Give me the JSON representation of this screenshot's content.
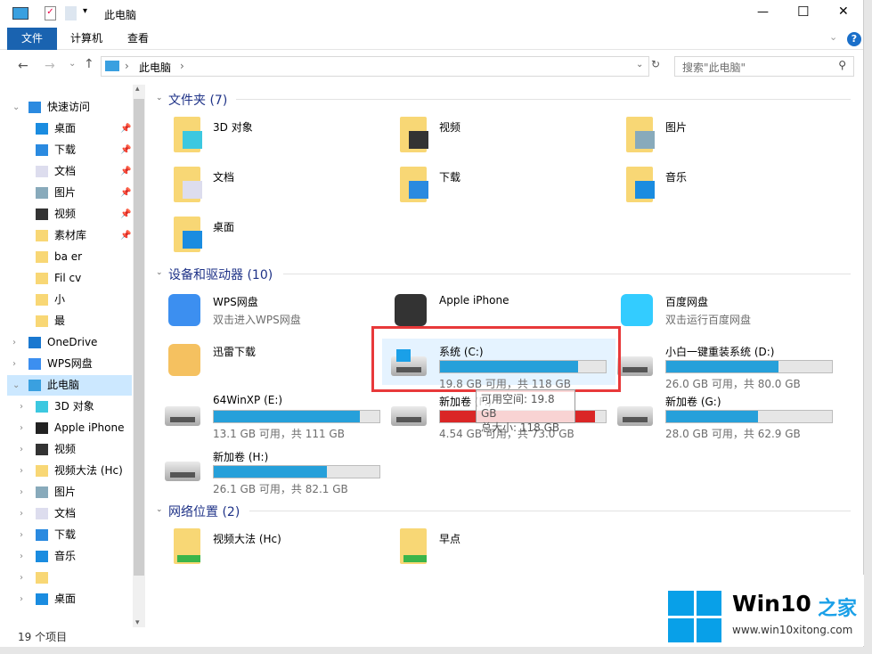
{
  "window": {
    "title": "此电脑",
    "minimize": "—",
    "maximize": "☐",
    "close": "✕"
  },
  "ribbon": {
    "tabs": [
      "文件",
      "计算机",
      "查看"
    ],
    "help": "?"
  },
  "address": {
    "path": "此电脑",
    "search_placeholder": "搜索\"此电脑\""
  },
  "nav": {
    "items": [
      {
        "label": "快速访问",
        "level": 0,
        "chev": "⌄",
        "icon": "star-icon"
      },
      {
        "label": "桌面",
        "level": 1,
        "pin": true,
        "icon": "desktop-icon"
      },
      {
        "label": "下载",
        "level": 1,
        "pin": true,
        "icon": "download-icon"
      },
      {
        "label": "文档",
        "level": 1,
        "pin": true,
        "icon": "document-icon"
      },
      {
        "label": "图片",
        "level": 1,
        "pin": true,
        "icon": "picture-icon"
      },
      {
        "label": "视频",
        "level": 1,
        "pin": true,
        "icon": "video-icon"
      },
      {
        "label": "素材库",
        "level": 1,
        "pin": true,
        "icon": "folder-icon"
      },
      {
        "label": "ba  er",
        "level": 1,
        "icon": "folder-icon"
      },
      {
        "label": "Fil   cv",
        "level": 1,
        "icon": "folder-icon"
      },
      {
        "label": "小",
        "level": 1,
        "icon": "folder-icon"
      },
      {
        "label": "最",
        "level": 1,
        "icon": "folder-icon"
      },
      {
        "label": "OneDrive",
        "level": 0,
        "chev": "›",
        "icon": "onedrive-icon"
      },
      {
        "label": "WPS网盘",
        "level": 0,
        "chev": "›",
        "icon": "cloud-icon"
      },
      {
        "label": "此电脑",
        "level": 0,
        "chev": "⌄",
        "icon": "computer-icon",
        "selected": true
      },
      {
        "label": "3D 对象",
        "level": 0.5,
        "chev": "›",
        "icon": "cube-icon"
      },
      {
        "label": "Apple iPhone",
        "level": 0.5,
        "chev": "›",
        "icon": "phone-icon"
      },
      {
        "label": "视频",
        "level": 0.5,
        "chev": "›",
        "icon": "video-icon"
      },
      {
        "label": "视频大法 (Hc)",
        "level": 0.5,
        "chev": "›",
        "icon": "network-folder-icon"
      },
      {
        "label": "图片",
        "level": 0.5,
        "chev": "›",
        "icon": "picture-icon"
      },
      {
        "label": "文档",
        "level": 0.5,
        "chev": "›",
        "icon": "document-icon"
      },
      {
        "label": "下载",
        "level": 0.5,
        "chev": "›",
        "icon": "download-icon"
      },
      {
        "label": "音乐",
        "level": 0.5,
        "chev": "›",
        "icon": "music-icon"
      },
      {
        "label": "",
        "level": 0.5,
        "chev": "›",
        "icon": "network-folder-icon"
      },
      {
        "label": "桌面",
        "level": 0.5,
        "chev": "›",
        "icon": "desktop-icon"
      }
    ]
  },
  "sections": {
    "folders": "文件夹 (7)",
    "devices": "设备和驱动器 (10)",
    "network": "网络位置 (2)"
  },
  "folders": [
    "3D 对象",
    "视频",
    "图片",
    "文档",
    "下载",
    "音乐",
    "桌面"
  ],
  "devices": [
    {
      "label": "WPS网盘",
      "sub": "双击进入WPS网盘"
    },
    {
      "label": "Apple iPhone",
      "sub": ""
    },
    {
      "label": "百度网盘",
      "sub": "双击运行百度网盘"
    },
    {
      "label": "迅雷下载",
      "sub": ""
    }
  ],
  "drives": [
    {
      "label": "系统 (C:)",
      "info": "19.8 GB 可用，共 118 GB",
      "used_fraction": 0.832,
      "selected": true
    },
    {
      "label": "小白一键重装系统 (D:)",
      "info": "26.0 GB 可用，共 80.0 GB",
      "used_fraction": 0.675
    },
    {
      "label": "64WinXP  (E:)",
      "info": "13.1 GB 可用，共 111 GB",
      "used_fraction": 0.882
    },
    {
      "label": "新加卷 (F:)",
      "info": "4.54 GB 可用，共 73.0 GB",
      "used_fraction": 0.938,
      "low": true
    },
    {
      "label": "新加卷 (G:)",
      "info": "28.0 GB 可用，共 62.9 GB",
      "used_fraction": 0.555
    },
    {
      "label": "新加卷 (H:)",
      "info": "26.1 GB 可用，共 82.1 GB",
      "used_fraction": 0.682
    }
  ],
  "network": [
    "视频大法 (Hc)",
    "早点"
  ],
  "tooltip": {
    "free": "可用空间: 19.8 GB",
    "total": "总大小: 118 GB"
  },
  "status": "19 个项目",
  "watermark": {
    "brand": "Win10",
    "brand2": "之家",
    "url": "www.win10xitong.com"
  },
  "colors": {
    "accent": "#1a63b0",
    "bar": "#26a0da",
    "bar_low": "#da2626",
    "selection": "#cce8ff",
    "highlight_box": "#e8393a"
  }
}
